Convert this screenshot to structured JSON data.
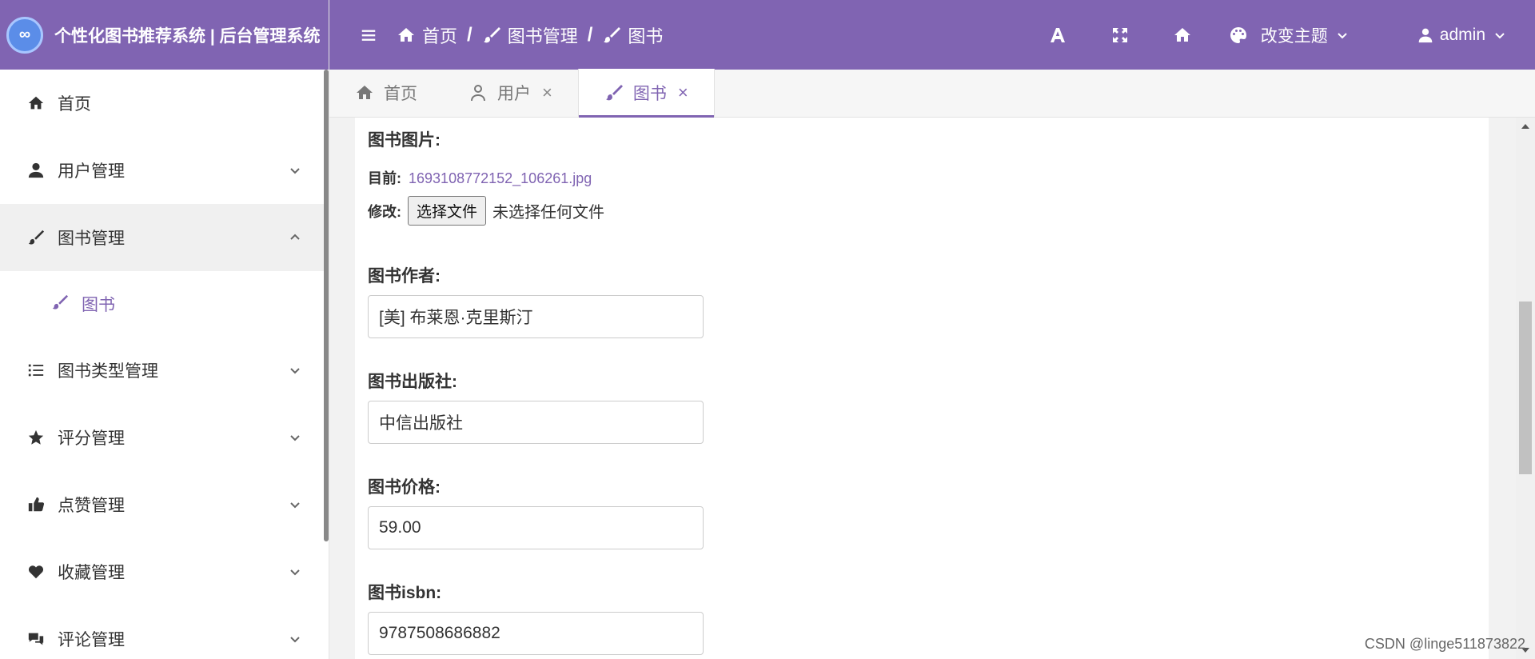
{
  "app": {
    "title": "个性化图书推荐系统 | 后台管理系统",
    "logo_text": "∞"
  },
  "sidebar": {
    "items": [
      {
        "label": "首页",
        "icon": "home-icon"
      },
      {
        "label": "用户管理",
        "icon": "user-icon"
      },
      {
        "label": "图书管理",
        "icon": "brush-icon",
        "expanded": true
      },
      {
        "label": "图书",
        "icon": "brush-icon",
        "sub": true,
        "active": true
      },
      {
        "label": "图书类型管理",
        "icon": "list-icon"
      },
      {
        "label": "评分管理",
        "icon": "star-icon"
      },
      {
        "label": "点赞管理",
        "icon": "thumbs-up-icon"
      },
      {
        "label": "收藏管理",
        "icon": "heart-icon"
      },
      {
        "label": "评论管理",
        "icon": "comments-icon"
      }
    ]
  },
  "header": {
    "breadcrumb": [
      "首页",
      "图书管理",
      "图书"
    ],
    "theme_label": "改变主题",
    "user_label": "admin"
  },
  "tabs": [
    {
      "label": "首页",
      "closable": false
    },
    {
      "label": "用户",
      "closable": true
    },
    {
      "label": "图书",
      "closable": true,
      "active": true
    }
  ],
  "form": {
    "image_label": "图书图片:",
    "current_prefix": "目前:",
    "current_file": "1693108772152_106261.jpg",
    "modify_prefix": "修改:",
    "file_button": "选择文件",
    "file_none": "未选择任何文件",
    "author_label": "图书作者:",
    "author_value": "[美] 布莱恩·克里斯汀",
    "publisher_label": "图书出版社:",
    "publisher_value": "中信出版社",
    "price_label": "图书价格:",
    "price_value": "59.00",
    "isbn_label": "图书isbn:",
    "isbn_value": "9787508686882"
  },
  "watermark": "CSDN @linge511873822",
  "colors": {
    "accent": "#8064b2"
  }
}
